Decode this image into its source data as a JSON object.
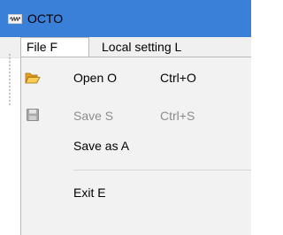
{
  "window": {
    "title": "OCTO",
    "app_icon": "octo-app-icon"
  },
  "menubar": {
    "items": [
      {
        "label": "File F",
        "state": "open"
      },
      {
        "label": "Local setting L",
        "state": "closed"
      }
    ]
  },
  "file_menu": {
    "items": [
      {
        "label": "Open O",
        "shortcut": "Ctrl+O",
        "icon": "open-folder-icon",
        "enabled": true
      },
      {
        "label": "Save S",
        "shortcut": "Ctrl+S",
        "icon": "save-disk-icon",
        "enabled": false
      },
      {
        "label": "Save as A",
        "shortcut": "",
        "icon": "",
        "enabled": true
      },
      {
        "label": "Exit E",
        "shortcut": "",
        "icon": "",
        "enabled": true
      }
    ]
  },
  "colors": {
    "titlebar": "#3a7fd8",
    "menu_background": "#f2f2f2",
    "disabled_text": "#8d8d8d",
    "folder_icon": "#f0b429"
  }
}
